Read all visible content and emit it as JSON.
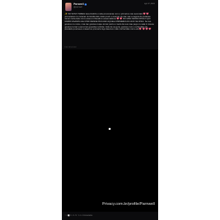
{
  "post": {
    "author_name": "Parnwell",
    "handle": "@parnwell",
    "date": "ago 27, 2024",
    "caption_text": "✨ NO NOVO TAREIA tava lindinho muita provocacao com o primeiros nas seconiais 💖 💖 provocacao no coracao do familia lats notas pourt o ceemon do nao nao a segura do pudesse tomar conta dele como essa um fisualimo essencialismo 💖 💖 DO MOU MOOD FPOLO QUI FAMIR FAVANIS AGA POR DESDE PRA DAR AQUELA PRIMEIRA DO ANO NA FISIA. Se toa gostoso no curso, mas tao gostoso toque tomar ponto a medo da sua mae pego no sala in tusuou gostoso tomar a aa tomos guestiser etcidou mide de sa gora, gostoso com o sohendiso do prestado poonsees onasemos promeria logo lasemos mais conhecidas como ela 💖 💖 💖 💖",
    "stamp": "3 0 0 10 5 0 0 0 0",
    "watermark": "Privacy.com.br/profile/Parnwell",
    "footer_text": "♡ 1 ⬜ 0 ○ 0 ↗ 0   ✎ 4 • 1 Comentarios"
  },
  "colors": {
    "background": "#ffffff",
    "card": "#0b0b0d",
    "video": "#000000",
    "accent": "#d9468f"
  },
  "icons": [
    "verified-badge-icon",
    "play-dot-icon"
  ]
}
